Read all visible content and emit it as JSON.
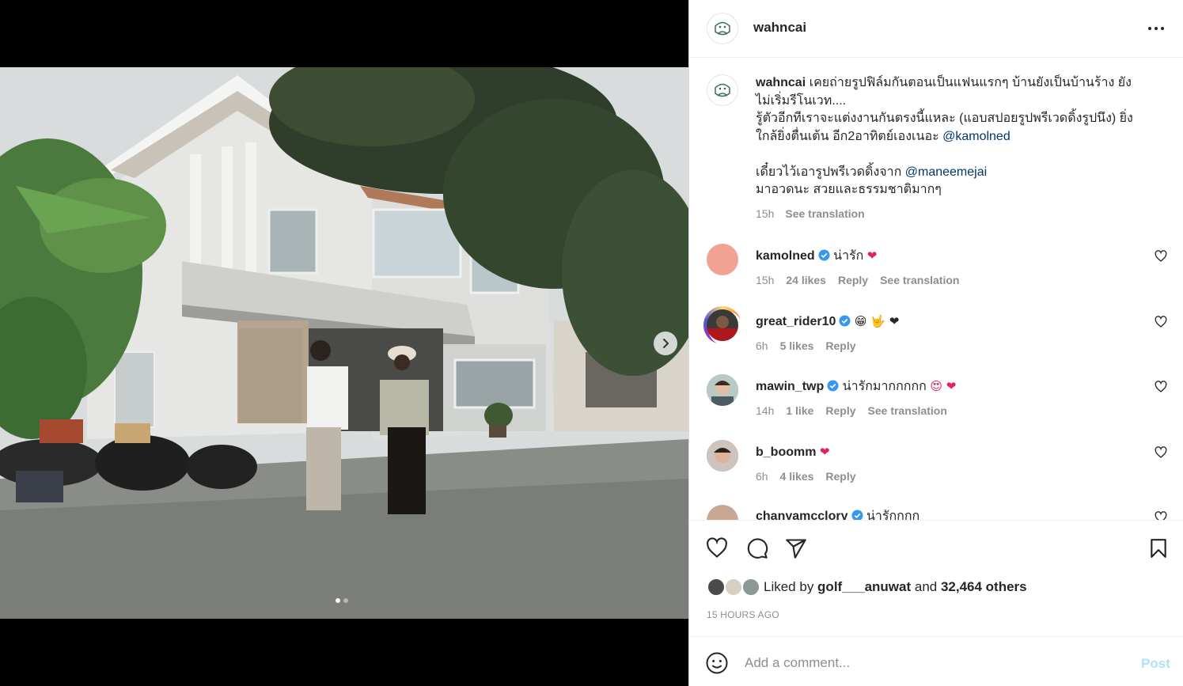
{
  "post": {
    "username": "wahncai",
    "caption_lines": [
      "เคยถ่ายรูปฟิล์มกันตอนเป็นแฟนแรกๆ บ้านยังเป็นบ้านร้าง ยัง",
      "ไม่เริ่มรีโนเวท....",
      "รู้ตัวอีกทีเราจะแต่งงานกันตรงนี้แหละ (แอบสปอยรูปพรีเวดดิ้งรูปนึง) ยิ่ง",
      "ใกล้ยิ่งตื่นเต้น อีก2อาทิตย์เองเนอะ "
    ],
    "caption_mention_1": "@kamolned",
    "caption_line_5": "เดี๋ยวไว้เอารูปพรีเวดดิ้งจาก ",
    "caption_mention_2": "@maneemejai",
    "caption_line_6": "มาอวดนะ สวยและธรรมชาติมากๆ",
    "caption_time": "15h",
    "caption_translate": "See translation"
  },
  "comments": [
    {
      "username": "kamolned",
      "verified": true,
      "text": "น่ารัก",
      "emojis": "❤",
      "time": "15h",
      "likes": "24 likes",
      "reply": "Reply",
      "translate": "See translation",
      "avatar_color": "#f2a195"
    },
    {
      "username": "great_rider10",
      "verified": true,
      "text": "",
      "emojis": "😁 🤟 ❤",
      "time": "6h",
      "likes": "5 likes",
      "reply": "Reply",
      "translate": "",
      "avatar_color": "#3a3a3a"
    },
    {
      "username": "mawin_twp",
      "verified": true,
      "text": "น่ารักมากกกกก",
      "emojis": "😍 ❤",
      "time": "14h",
      "likes": "1 like",
      "reply": "Reply",
      "translate": "See translation",
      "avatar_color": "#8aa3a8"
    },
    {
      "username": "b_boomm",
      "verified": false,
      "text": "",
      "emojis": "❤",
      "time": "6h",
      "likes": "4 likes",
      "reply": "Reply",
      "translate": "",
      "avatar_color": "#9c8a84"
    },
    {
      "username": "chanyamcclory",
      "verified": true,
      "text": "น่ารักกกก",
      "emojis": "",
      "time": "",
      "likes": "",
      "reply": "",
      "translate": "",
      "avatar_color": "#c9a893"
    }
  ],
  "actions": {
    "liked_prefix": "Liked by ",
    "liked_user": "golf___anuwat",
    "liked_and": " and ",
    "liked_others": "32,464 others",
    "time_ago": "15 HOURS AGO"
  },
  "add_comment": {
    "placeholder": "Add a comment...",
    "post_label": "Post"
  },
  "carousel": {
    "total": 2,
    "current": 1
  },
  "colors": {
    "verified": "#3897f0",
    "mention": "#00376b",
    "post_disabled": "#b2dffc"
  },
  "icons": [
    "more-icon",
    "heart-icon",
    "comment-icon",
    "share-icon",
    "bookmark-icon",
    "smile-icon",
    "chevron-right-icon",
    "verified-icon"
  ]
}
